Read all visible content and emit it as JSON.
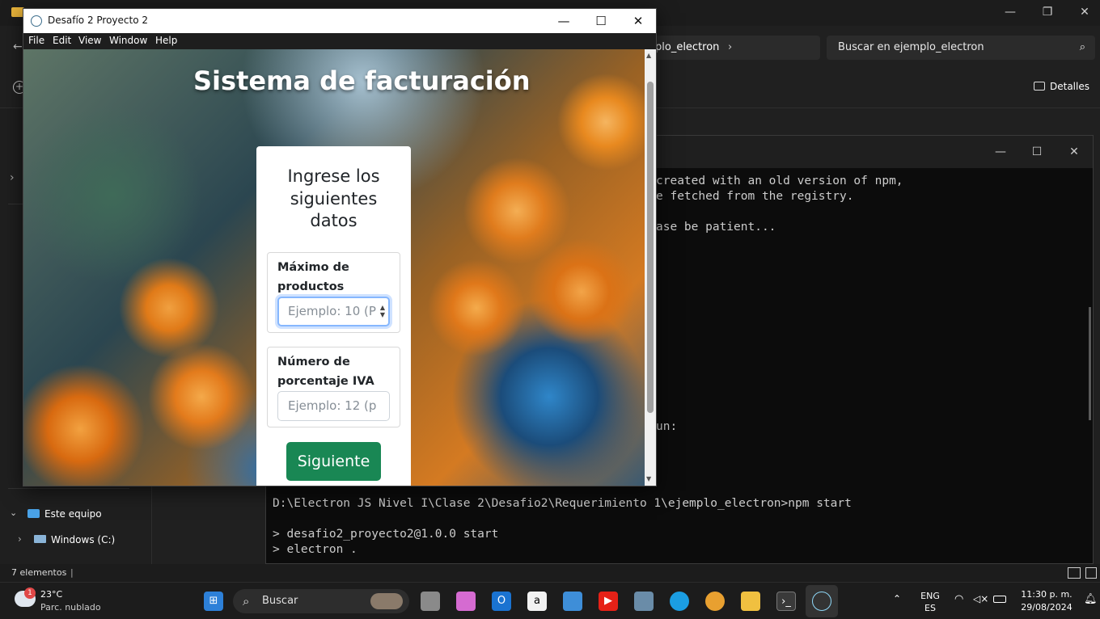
{
  "explorer": {
    "address_tail": "plo_electron",
    "search_placeholder": "Buscar en ejemplo_electron",
    "details_label": "Detalles",
    "nav_items": [
      "Este equipo",
      "Windows (C:)"
    ],
    "status_text": "7 elementos"
  },
  "terminal": {
    "lines": [
      "created with an old version of npm,",
      "e fetched from the registry.",
      "ase be patient...",
      "un:",
      "D:\\Electron JS Nivel I\\Clase 2\\Desafio2\\Requerimiento 1\\ejemplo_electron>npm start",
      "> desafio2_proyecto2@1.0.0 start",
      "> electron ."
    ]
  },
  "app": {
    "window_title": "Desafío 2 Proyecto 2",
    "menu": [
      "File",
      "Edit",
      "View",
      "Window",
      "Help"
    ],
    "heading": "Sistema de facturación",
    "card_title_lines": [
      "Ingrese los",
      "siguientes",
      "datos"
    ],
    "field_max": {
      "label_lines": [
        "Máximo de",
        "productos"
      ],
      "placeholder": "Ejemplo: 10 (P"
    },
    "field_iva": {
      "label_lines": [
        "Número de",
        "porcentaje IVA"
      ],
      "placeholder": "Ejemplo: 12 (p"
    },
    "submit_label": "Siguiente"
  },
  "taskbar": {
    "weather_temp": "23°C",
    "weather_desc": "Parc. nublado",
    "weather_badge": "1",
    "search_label": "Buscar",
    "lang_line1": "ENG",
    "lang_line2": "ES",
    "time": "11:30 p. m.",
    "date": "29/08/2024"
  },
  "colors": {
    "accent_button": "#198754",
    "focus_ring": "#86b7fe"
  }
}
